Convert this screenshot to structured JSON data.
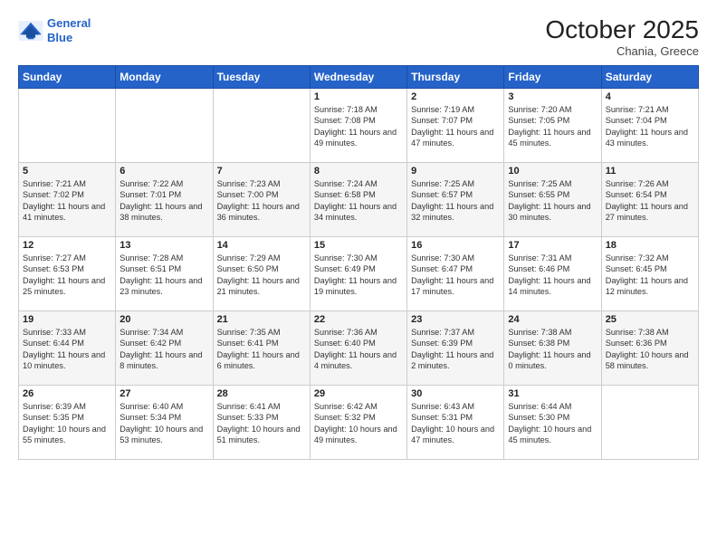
{
  "header": {
    "logo_line1": "General",
    "logo_line2": "Blue",
    "month": "October 2025",
    "location": "Chania, Greece"
  },
  "weekdays": [
    "Sunday",
    "Monday",
    "Tuesday",
    "Wednesday",
    "Thursday",
    "Friday",
    "Saturday"
  ],
  "weeks": [
    [
      {
        "day": "",
        "info": ""
      },
      {
        "day": "",
        "info": ""
      },
      {
        "day": "",
        "info": ""
      },
      {
        "day": "1",
        "info": "Sunrise: 7:18 AM\nSunset: 7:08 PM\nDaylight: 11 hours and 49 minutes."
      },
      {
        "day": "2",
        "info": "Sunrise: 7:19 AM\nSunset: 7:07 PM\nDaylight: 11 hours and 47 minutes."
      },
      {
        "day": "3",
        "info": "Sunrise: 7:20 AM\nSunset: 7:05 PM\nDaylight: 11 hours and 45 minutes."
      },
      {
        "day": "4",
        "info": "Sunrise: 7:21 AM\nSunset: 7:04 PM\nDaylight: 11 hours and 43 minutes."
      }
    ],
    [
      {
        "day": "5",
        "info": "Sunrise: 7:21 AM\nSunset: 7:02 PM\nDaylight: 11 hours and 41 minutes."
      },
      {
        "day": "6",
        "info": "Sunrise: 7:22 AM\nSunset: 7:01 PM\nDaylight: 11 hours and 38 minutes."
      },
      {
        "day": "7",
        "info": "Sunrise: 7:23 AM\nSunset: 7:00 PM\nDaylight: 11 hours and 36 minutes."
      },
      {
        "day": "8",
        "info": "Sunrise: 7:24 AM\nSunset: 6:58 PM\nDaylight: 11 hours and 34 minutes."
      },
      {
        "day": "9",
        "info": "Sunrise: 7:25 AM\nSunset: 6:57 PM\nDaylight: 11 hours and 32 minutes."
      },
      {
        "day": "10",
        "info": "Sunrise: 7:25 AM\nSunset: 6:55 PM\nDaylight: 11 hours and 30 minutes."
      },
      {
        "day": "11",
        "info": "Sunrise: 7:26 AM\nSunset: 6:54 PM\nDaylight: 11 hours and 27 minutes."
      }
    ],
    [
      {
        "day": "12",
        "info": "Sunrise: 7:27 AM\nSunset: 6:53 PM\nDaylight: 11 hours and 25 minutes."
      },
      {
        "day": "13",
        "info": "Sunrise: 7:28 AM\nSunset: 6:51 PM\nDaylight: 11 hours and 23 minutes."
      },
      {
        "day": "14",
        "info": "Sunrise: 7:29 AM\nSunset: 6:50 PM\nDaylight: 11 hours and 21 minutes."
      },
      {
        "day": "15",
        "info": "Sunrise: 7:30 AM\nSunset: 6:49 PM\nDaylight: 11 hours and 19 minutes."
      },
      {
        "day": "16",
        "info": "Sunrise: 7:30 AM\nSunset: 6:47 PM\nDaylight: 11 hours and 17 minutes."
      },
      {
        "day": "17",
        "info": "Sunrise: 7:31 AM\nSunset: 6:46 PM\nDaylight: 11 hours and 14 minutes."
      },
      {
        "day": "18",
        "info": "Sunrise: 7:32 AM\nSunset: 6:45 PM\nDaylight: 11 hours and 12 minutes."
      }
    ],
    [
      {
        "day": "19",
        "info": "Sunrise: 7:33 AM\nSunset: 6:44 PM\nDaylight: 11 hours and 10 minutes."
      },
      {
        "day": "20",
        "info": "Sunrise: 7:34 AM\nSunset: 6:42 PM\nDaylight: 11 hours and 8 minutes."
      },
      {
        "day": "21",
        "info": "Sunrise: 7:35 AM\nSunset: 6:41 PM\nDaylight: 11 hours and 6 minutes."
      },
      {
        "day": "22",
        "info": "Sunrise: 7:36 AM\nSunset: 6:40 PM\nDaylight: 11 hours and 4 minutes."
      },
      {
        "day": "23",
        "info": "Sunrise: 7:37 AM\nSunset: 6:39 PM\nDaylight: 11 hours and 2 minutes."
      },
      {
        "day": "24",
        "info": "Sunrise: 7:38 AM\nSunset: 6:38 PM\nDaylight: 11 hours and 0 minutes."
      },
      {
        "day": "25",
        "info": "Sunrise: 7:38 AM\nSunset: 6:36 PM\nDaylight: 10 hours and 58 minutes."
      }
    ],
    [
      {
        "day": "26",
        "info": "Sunrise: 6:39 AM\nSunset: 5:35 PM\nDaylight: 10 hours and 55 minutes."
      },
      {
        "day": "27",
        "info": "Sunrise: 6:40 AM\nSunset: 5:34 PM\nDaylight: 10 hours and 53 minutes."
      },
      {
        "day": "28",
        "info": "Sunrise: 6:41 AM\nSunset: 5:33 PM\nDaylight: 10 hours and 51 minutes."
      },
      {
        "day": "29",
        "info": "Sunrise: 6:42 AM\nSunset: 5:32 PM\nDaylight: 10 hours and 49 minutes."
      },
      {
        "day": "30",
        "info": "Sunrise: 6:43 AM\nSunset: 5:31 PM\nDaylight: 10 hours and 47 minutes."
      },
      {
        "day": "31",
        "info": "Sunrise: 6:44 AM\nSunset: 5:30 PM\nDaylight: 10 hours and 45 minutes."
      },
      {
        "day": "",
        "info": ""
      }
    ]
  ]
}
